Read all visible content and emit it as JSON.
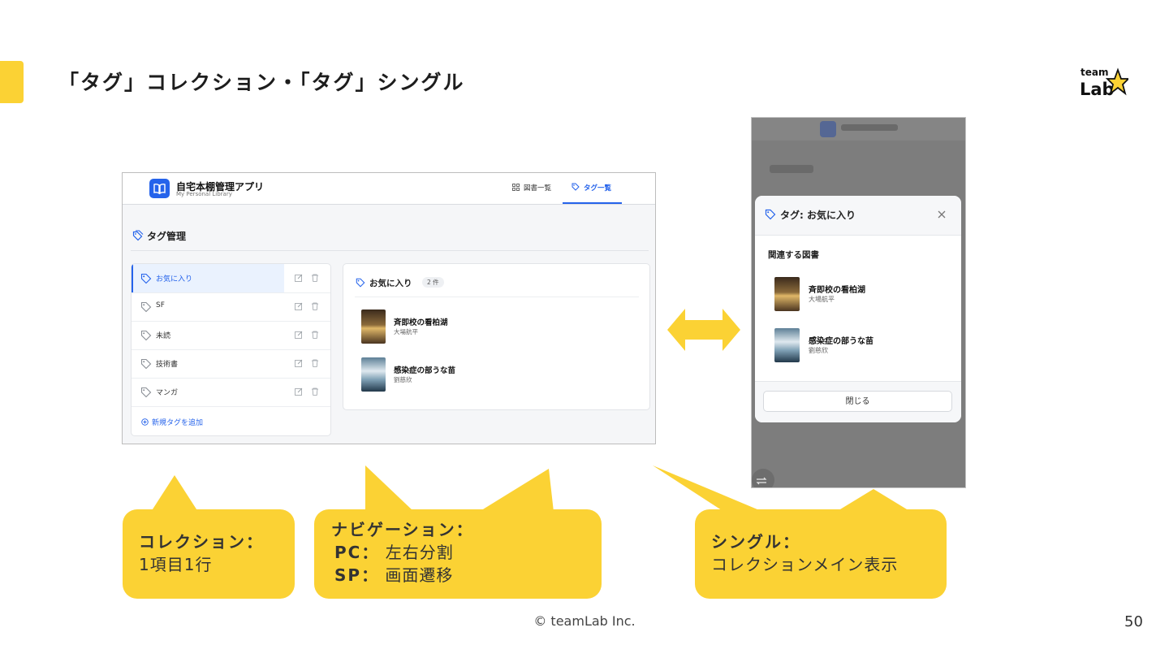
{
  "slide": {
    "title": "「タグ」コレクション・「タグ」シングル",
    "logo_text_top": "team",
    "logo_text_bottom": "Lab",
    "copyright": "© teamLab Inc.",
    "page_number": "50"
  },
  "colors": {
    "accent": "#fbd234",
    "primary": "#2563eb"
  },
  "pc": {
    "app_title": "自宅本棚管理アプリ",
    "app_subtitle": "My Personal Library",
    "nav": [
      {
        "label": "図書一覧",
        "icon": "grid-icon"
      },
      {
        "label": "タグ一覧",
        "icon": "tag-icon",
        "active": true
      }
    ],
    "section_title": "タグ管理",
    "tags": [
      {
        "name": "お気に入り",
        "active": true
      },
      {
        "name": "SF"
      },
      {
        "name": "未読"
      },
      {
        "name": "技術書"
      },
      {
        "name": "マンガ"
      }
    ],
    "add_tag_label": "新規タグを追加",
    "detail": {
      "title": "お気に入り",
      "count": "2 件",
      "books": [
        {
          "title": "斉即校の看柏湖",
          "author": "大場航平"
        },
        {
          "title": "感染症の部うな苗",
          "author": "劉慈欣"
        }
      ]
    }
  },
  "sp": {
    "modal_title": "タグ: お気に入り",
    "related_heading": "関連する図書",
    "books": [
      {
        "title": "斉即校の看柏湖",
        "author": "大場航平"
      },
      {
        "title": "感染症の部うな苗",
        "author": "劉慈欣"
      }
    ],
    "close_button": "閉じる"
  },
  "callouts": {
    "collection": {
      "heading": "コレクション：",
      "body": "1項目1行"
    },
    "navigation": {
      "heading": "ナビゲーション：",
      "pc_label": "PC：",
      "pc_body": "左右分割",
      "sp_label": "SP：",
      "sp_body": "画面遷移"
    },
    "single": {
      "heading": "シングル：",
      "body": "コレクションメイン表示"
    }
  }
}
